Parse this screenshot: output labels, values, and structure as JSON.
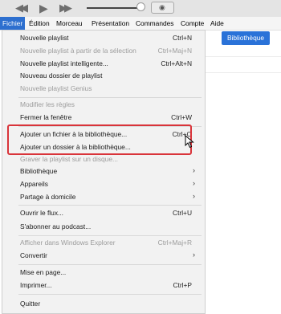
{
  "menubar": {
    "items": [
      "Fichier",
      "Édition",
      "Morceau",
      "Présentation",
      "Commandes",
      "Compte",
      "Aide"
    ]
  },
  "library_button": "Bibliothèque",
  "menu": {
    "items": [
      {
        "label": "Nouvelle playlist",
        "shortcut": "Ctrl+N",
        "enabled": true
      },
      {
        "label": "Nouvelle playlist à partir de la sélection",
        "shortcut": "Ctrl+Maj+N",
        "enabled": false
      },
      {
        "label": "Nouvelle playlist intelligente...",
        "shortcut": "Ctrl+Alt+N",
        "enabled": true
      },
      {
        "label": "Nouveau dossier de playlist",
        "shortcut": "",
        "enabled": true
      },
      {
        "label": "Nouvelle playlist Genius",
        "shortcut": "",
        "enabled": false
      },
      {
        "label": "Modifier les règles",
        "shortcut": "",
        "enabled": false
      },
      {
        "label": "Fermer la fenêtre",
        "shortcut": "Ctrl+W",
        "enabled": true
      },
      {
        "label": "Ajouter un fichier à la bibliothèque...",
        "shortcut": "Ctrl+O",
        "enabled": true
      },
      {
        "label": "Ajouter un dossier à la bibliothèque...",
        "shortcut": "",
        "enabled": true
      },
      {
        "label": "Graver la playlist sur un disque...",
        "shortcut": "",
        "enabled": false
      },
      {
        "label": "Bibliothèque",
        "shortcut": "",
        "enabled": true,
        "submenu": true
      },
      {
        "label": "Appareils",
        "shortcut": "",
        "enabled": true,
        "submenu": true
      },
      {
        "label": "Partage à domicile",
        "shortcut": "",
        "enabled": true,
        "submenu": true
      },
      {
        "label": "Ouvrir le flux...",
        "shortcut": "Ctrl+U",
        "enabled": true
      },
      {
        "label": "S'abonner au podcast...",
        "shortcut": "",
        "enabled": true
      },
      {
        "label": "Afficher dans Windows Explorer",
        "shortcut": "Ctrl+Maj+R",
        "enabled": false
      },
      {
        "label": "Convertir",
        "shortcut": "",
        "enabled": true,
        "submenu": true
      },
      {
        "label": "Mise en page...",
        "shortcut": "",
        "enabled": true
      },
      {
        "label": "Imprimer...",
        "shortcut": "Ctrl+P",
        "enabled": true
      },
      {
        "label": "Quitter",
        "shortcut": "",
        "enabled": true
      }
    ]
  },
  "icons": {
    "back": "rewind-icon",
    "play": "play-icon",
    "forward": "fast-forward-icon",
    "airplay": "airplay-icon",
    "submenu": "chevron-right-icon",
    "cursor": "mouse-cursor-icon"
  },
  "colors": {
    "menu_active": "#2d6fcf",
    "library_button": "#2a72d8",
    "highlight_box": "#d9343a"
  }
}
